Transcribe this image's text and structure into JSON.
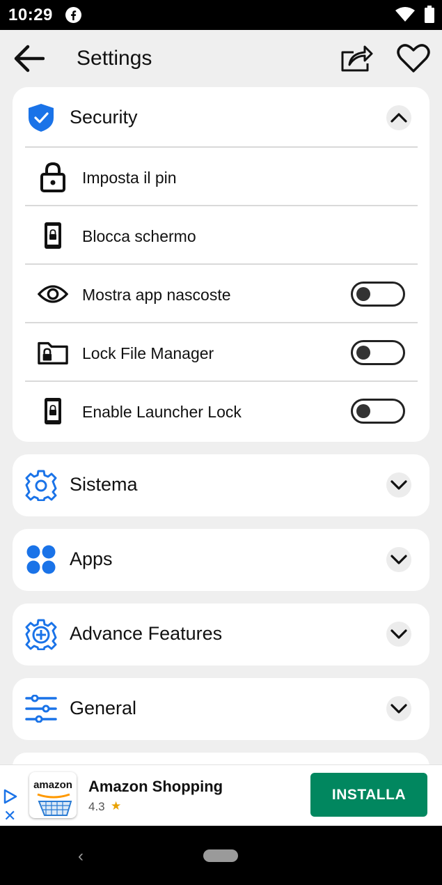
{
  "status_bar": {
    "time": "10:29",
    "icons": [
      "facebook-icon",
      "wifi-icon",
      "battery-icon"
    ]
  },
  "header": {
    "title": "Settings",
    "back_icon": "arrow-left-icon",
    "share_icon": "share-icon",
    "favorite_icon": "heart-icon"
  },
  "sections": {
    "security": {
      "title": "Security",
      "icon": "shield-check-icon",
      "expanded": true,
      "items": [
        {
          "label": "Imposta il pin",
          "icon": "padlock-icon",
          "has_toggle": false
        },
        {
          "label": "Blocca schermo",
          "icon": "phone-lock-icon",
          "has_toggle": false
        },
        {
          "label": "Mostra app nascoste",
          "icon": "eye-icon",
          "has_toggle": true,
          "on": false
        },
        {
          "label": "Lock File Manager",
          "icon": "folder-lock-icon",
          "has_toggle": true,
          "on": false
        },
        {
          "label": "Enable Launcher Lock",
          "icon": "phone-lock-icon",
          "has_toggle": true,
          "on": false
        }
      ]
    },
    "sistema": {
      "title": "Sistema",
      "icon": "gear-icon",
      "expanded": false
    },
    "apps": {
      "title": "Apps",
      "icon": "apps-dots-icon",
      "expanded": false
    },
    "advance": {
      "title": "Advance Features",
      "icon": "gear-plus-icon",
      "expanded": false
    },
    "general": {
      "title": "General",
      "icon": "sliders-icon",
      "expanded": false
    }
  },
  "ad": {
    "logo_text": "amazon",
    "app_name": "Amazon Shopping",
    "rating": "4.3",
    "install_label": "INSTALLA"
  },
  "colors": {
    "accent": "#1a73e8",
    "install_button": "#01875f",
    "background": "#efefef",
    "card": "#ffffff"
  }
}
